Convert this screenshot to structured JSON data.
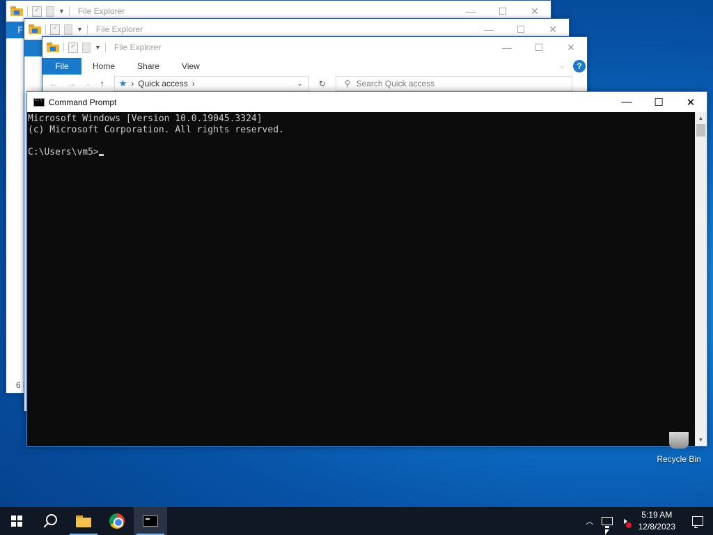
{
  "explorer_windows": [
    {
      "title": "File Explorer",
      "status": "6 i",
      "ribbon_file": "F"
    },
    {
      "title": "File Explorer"
    },
    {
      "title": "File Explorer",
      "ribbon_tabs": [
        "File",
        "Home",
        "Share",
        "View"
      ],
      "address": "Quick access",
      "search_placeholder": "Search Quick access"
    }
  ],
  "cmd": {
    "title": "Command Prompt",
    "lines": [
      "Microsoft Windows [Version 10.0.19045.3324]",
      "(c) Microsoft Corporation. All rights reserved.",
      "",
      "C:\\Users\\vm5>"
    ]
  },
  "desktop": {
    "recycle_bin_label": "Recycle Bin"
  },
  "taskbar": {
    "apps": [
      "start",
      "search",
      "file-explorer",
      "chrome",
      "command-prompt"
    ],
    "active_app": "command-prompt",
    "clock_time": "5:19 AM",
    "clock_date": "12/8/2023"
  }
}
